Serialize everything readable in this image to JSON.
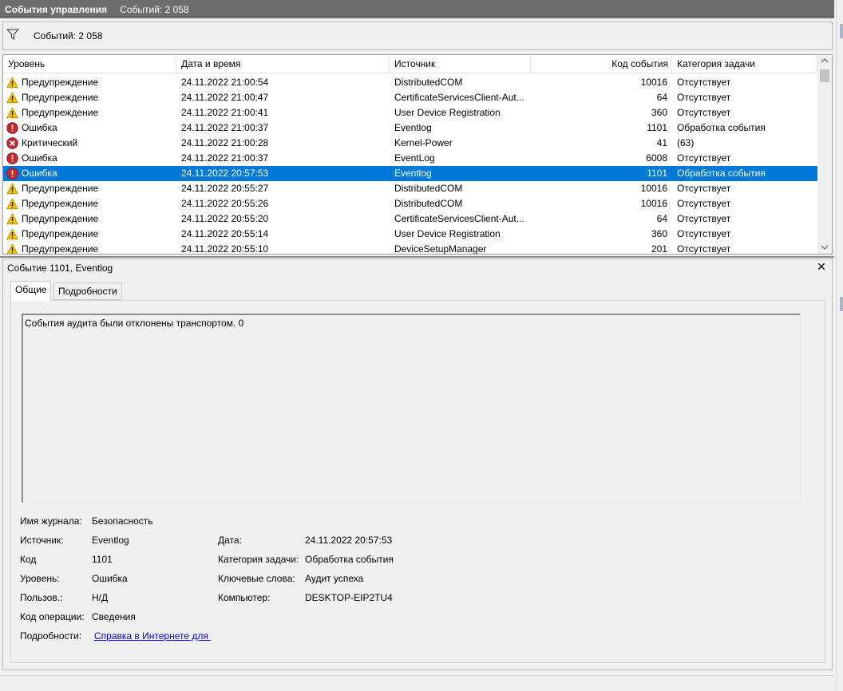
{
  "titlebar": {
    "title": "События управления",
    "count": "Событий: 2 058"
  },
  "filter": {
    "icon": "filter-icon",
    "count": "Событий: 2 058"
  },
  "grid": {
    "columns": [
      "Уровень",
      "Дата и время",
      "Источник",
      "Код события",
      "Категория задачи"
    ],
    "selected_index": 6,
    "rows": [
      {
        "level": "Предупреждение",
        "icon": "warning-icon",
        "date": "24.11.2022 21:00:54",
        "source": "DistributedCOM",
        "code": "10016",
        "category": "Отсутствует"
      },
      {
        "level": "Предупреждение",
        "icon": "warning-icon",
        "date": "24.11.2022 21:00:47",
        "source": "CertificateServicesClient-Aut...",
        "code": "64",
        "category": "Отсутствует"
      },
      {
        "level": "Предупреждение",
        "icon": "warning-icon",
        "date": "24.11.2022 21:00:41",
        "source": "User Device Registration",
        "code": "360",
        "category": "Отсутствует"
      },
      {
        "level": "Ошибка",
        "icon": "error-icon",
        "date": "24.11.2022 21:00:37",
        "source": "Eventlog",
        "code": "1101",
        "category": "Обработка события"
      },
      {
        "level": "Критический",
        "icon": "critical-icon",
        "date": "24.11.2022 21:00:28",
        "source": "Kernel-Power",
        "code": "41",
        "category": "(63)"
      },
      {
        "level": "Ошибка",
        "icon": "error-icon",
        "date": "24.11.2022 21:00:37",
        "source": "EventLog",
        "code": "6008",
        "category": "Отсутствует"
      },
      {
        "level": "Ошибка",
        "icon": "error-icon",
        "date": "24.11.2022 20:57:53",
        "source": "Eventlog",
        "code": "1101",
        "category": "Обработка события"
      },
      {
        "level": "Предупреждение",
        "icon": "warning-icon",
        "date": "24.11.2022 20:55:27",
        "source": "DistributedCOM",
        "code": "10016",
        "category": "Отсутствует"
      },
      {
        "level": "Предупреждение",
        "icon": "warning-icon",
        "date": "24.11.2022 20:55:26",
        "source": "DistributedCOM",
        "code": "10016",
        "category": "Отсутствует"
      },
      {
        "level": "Предупреждение",
        "icon": "warning-icon",
        "date": "24.11.2022 20:55:20",
        "source": "CertificateServicesClient-Aut...",
        "code": "64",
        "category": "Отсутствует"
      },
      {
        "level": "Предупреждение",
        "icon": "warning-icon",
        "date": "24.11.2022 20:55:14",
        "source": "User Device Registration",
        "code": "360",
        "category": "Отсутствует"
      },
      {
        "level": "Предупреждение",
        "icon": "warning-icon",
        "date": "24.11.2022 20:55:10",
        "source": "DeviceSetupManager",
        "code": "201",
        "category": "Отсутствует"
      }
    ]
  },
  "details": {
    "title": "Событие 1101, Eventlog",
    "close_icon": "close-icon",
    "tabs": [
      "Общие",
      "Подробности"
    ],
    "message": "События аудита были отклонены транспортом.  0",
    "log_name_label": "Имя журнала:",
    "log_name": "Безопасность",
    "source_label": "Источник:",
    "source": "Eventlog",
    "date_label": "Дата:",
    "date": "24.11.2022 20:57:53",
    "code_label": "Код",
    "code": "1101",
    "category_label": "Категория задачи:",
    "category": "Обработка события",
    "level_label": "Уровень:",
    "level": "Ошибка",
    "keywords_label": "Ключевые слова:",
    "keywords": "Аудит успеха",
    "user_label": "Пользов.:",
    "user": "Н/Д",
    "computer_label": "Компьютер:",
    "computer": "DESKTOP-EIP2TU4",
    "opcode_label": "Код операции:",
    "opcode": "Сведения",
    "more_label": "Подробности:",
    "more_link": "Справка в Интернете для "
  },
  "colors": {
    "selection": "#0078d7",
    "titlebar": "#6d6d6d",
    "warning": "#f5c400",
    "error": "#c4282d",
    "link": "#0000ee"
  }
}
